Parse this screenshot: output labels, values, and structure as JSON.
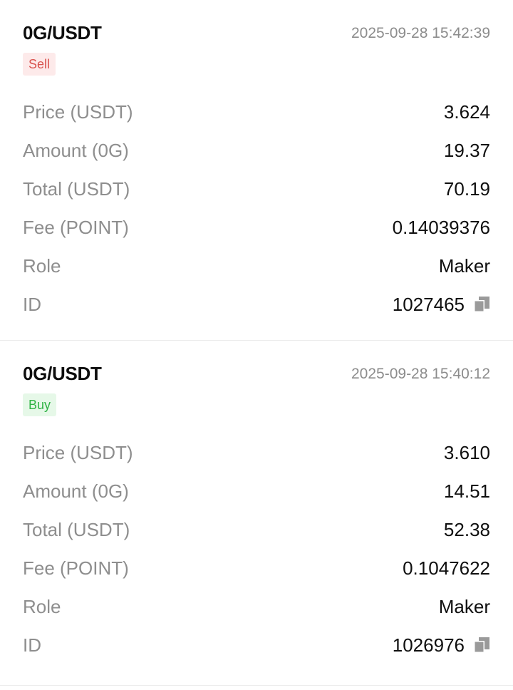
{
  "trades": [
    {
      "pair": "0G/USDT",
      "time": "2025-09-28 15:42:39",
      "side": "Sell",
      "rows": [
        {
          "label": "Price (USDT)",
          "value": "3.624"
        },
        {
          "label": "Amount (0G)",
          "value": "19.37"
        },
        {
          "label": "Total (USDT)",
          "value": "70.19"
        },
        {
          "label": "Fee (POINT)",
          "value": "0.14039376"
        },
        {
          "label": "Role",
          "value": "Maker"
        },
        {
          "label": "ID",
          "value": "1027465"
        }
      ]
    },
    {
      "pair": "0G/USDT",
      "time": "2025-09-28 15:40:12",
      "side": "Buy",
      "rows": [
        {
          "label": "Price (USDT)",
          "value": "3.610"
        },
        {
          "label": "Amount (0G)",
          "value": "14.51"
        },
        {
          "label": "Total (USDT)",
          "value": "52.38"
        },
        {
          "label": "Fee (POINT)",
          "value": "0.1047622"
        },
        {
          "label": "Role",
          "value": "Maker"
        },
        {
          "label": "ID",
          "value": "1026976"
        }
      ]
    }
  ],
  "icons": {
    "copy": "copy-icon"
  },
  "colors": {
    "sell_text": "#d9534f",
    "sell_bg": "#fdeaea",
    "buy_text": "#2fb344",
    "buy_bg": "#e6f8e8",
    "label": "#8e8e8e",
    "timestamp": "#8c8c8c"
  }
}
